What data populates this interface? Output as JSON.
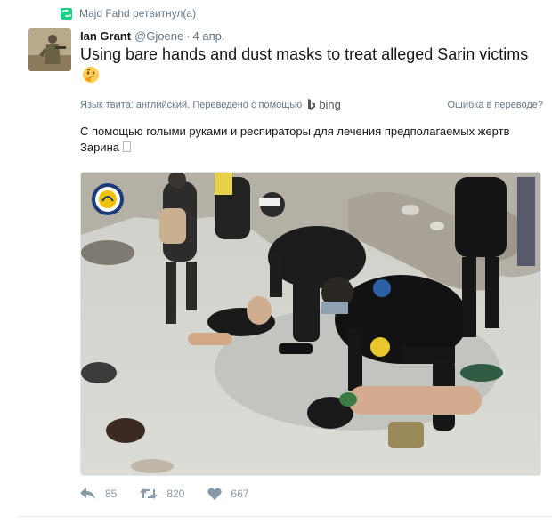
{
  "retweet": {
    "text": "Majd Fahd ретвитнул(а)",
    "icon": "retweet-icon",
    "color": "#19cf86"
  },
  "tweet": {
    "fullname": "Ian Grant",
    "username": "@Gjoene",
    "separator": "·",
    "time": "4 апр.",
    "text": "Using bare hands and dust masks to treat alleged Sarin victims",
    "emoji": "thinking-face-emoji"
  },
  "translation": {
    "info": "Язык твита: английский. Переведено с помощью",
    "provider": "bing",
    "error_link": "Ошибка в переводе?",
    "text": "С помощью голыми руками и респираторы для лечения предполагаемых жертв Зарина"
  },
  "media": {
    "type": "photo",
    "logo": "civil-defense-logo"
  },
  "actions": {
    "reply_count": "85",
    "retweet_count": "820",
    "like_count": "667"
  },
  "colors": {
    "text": "#14171a",
    "secondary": "#657786",
    "action": "#8899a6"
  }
}
